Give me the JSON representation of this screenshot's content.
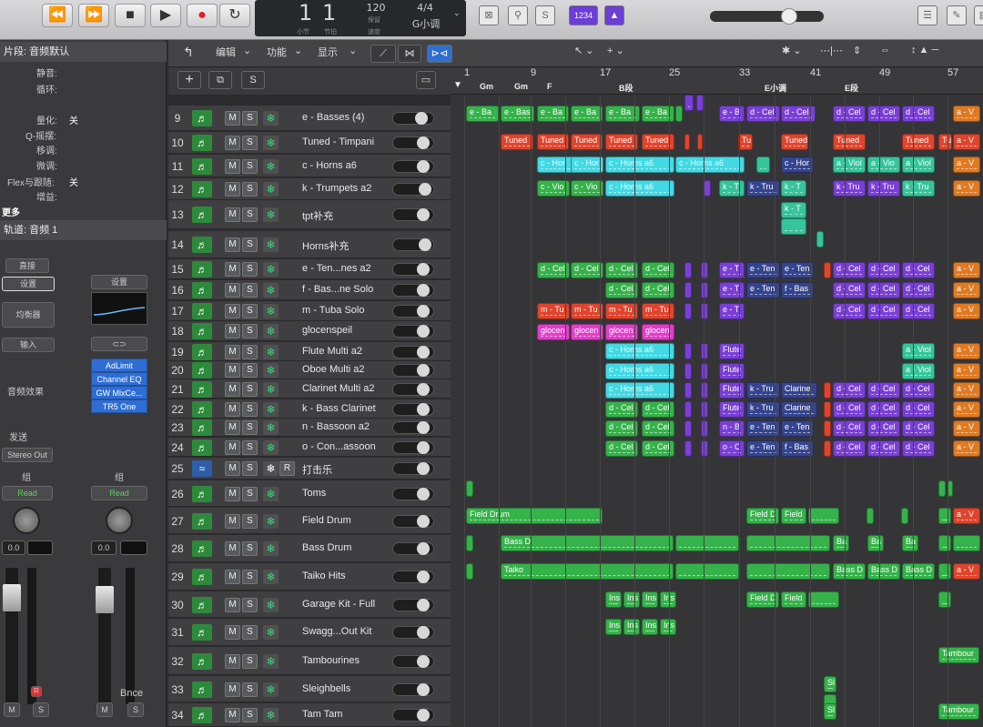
{
  "transport": {
    "bar": "1",
    "beat": "1",
    "bar_caption": "小节",
    "beat_caption": "节拍",
    "tempo": "120",
    "tempo_sub": "保留",
    "tempo_caption": "速度",
    "signature": "4/4",
    "key": "G小调",
    "count_in": "1234"
  },
  "inspector": {
    "region_title": "片段: 音频默认",
    "rows": [
      {
        "label": "静音:",
        "value": ""
      },
      {
        "label": "循环:",
        "value": ""
      },
      {
        "label": "量化:",
        "value": "关"
      },
      {
        "label": "Q-摇摆:",
        "value": ""
      },
      {
        "label": "移调:",
        "value": ""
      },
      {
        "label": "微调:",
        "value": ""
      },
      {
        "label": "Flex与跟随:",
        "value": "关"
      },
      {
        "label": "增益:",
        "value": ""
      }
    ],
    "more": "更多",
    "track_title": "轨道: 音频 1",
    "ch1": {
      "setting": "设置",
      "eq": "均衡器",
      "input": "输入",
      "fx": "音频效果",
      "send": "发送",
      "output": "Stereo Out",
      "group": "组",
      "automation": "Read",
      "value": "0.0"
    },
    "ch2": {
      "setting": "设置",
      "plugins": [
        "AdLimit",
        "Channel EQ",
        "GW MixCe...",
        "TR5 One"
      ],
      "group": "组",
      "automation": "Read",
      "value": "0.0",
      "name": "Bnce"
    },
    "direct": "直接"
  },
  "toolbar": {
    "edit": "编辑",
    "function": "功能",
    "view": "显示"
  },
  "tracks": [
    {
      "num": "9",
      "name": "e - Basses (4)"
    },
    {
      "num": "10",
      "name": "Tuned - Timpani"
    },
    {
      "num": "11",
      "name": "c - Horns a6"
    },
    {
      "num": "12",
      "name": "k - Trumpets a2"
    },
    {
      "num": "13",
      "name": "tpt补充"
    },
    {
      "num": "14",
      "name": "Horns补充"
    },
    {
      "num": "15",
      "name": "e - Ten...nes a2"
    },
    {
      "num": "16",
      "name": "f - Bas...ne Solo"
    },
    {
      "num": "17",
      "name": "m - Tuba Solo"
    },
    {
      "num": "18",
      "name": "glocenspeil"
    },
    {
      "num": "19",
      "name": "Flute Multi  a2"
    },
    {
      "num": "20",
      "name": "Oboe Multi a2"
    },
    {
      "num": "21",
      "name": "Clarinet Multi a2"
    },
    {
      "num": "22",
      "name": "k - Bass Clarinet"
    },
    {
      "num": "23",
      "name": "n - Bassoon a2"
    },
    {
      "num": "24",
      "name": "o - Con...assoon"
    },
    {
      "num": "25",
      "name": "打击乐"
    },
    {
      "num": "26",
      "name": "Toms"
    },
    {
      "num": "27",
      "name": "Field Drum"
    },
    {
      "num": "28",
      "name": "Bass Drum"
    },
    {
      "num": "29",
      "name": "Taiko Hits"
    },
    {
      "num": "30",
      "name": "Garage Kit - Full"
    },
    {
      "num": "31",
      "name": "Swagg...Out Kit"
    },
    {
      "num": "32",
      "name": "Tambourines"
    },
    {
      "num": "33",
      "name": "Sleighbells"
    },
    {
      "num": "34",
      "name": "Tam Tam"
    }
  ],
  "ruler": {
    "bars": [
      "1",
      "9",
      "17",
      "25",
      "33",
      "41",
      "49",
      "57"
    ],
    "markers": [
      "Gm",
      "Gm",
      "F",
      "B段",
      "E小调",
      "E段"
    ]
  },
  "regions": {
    "basses": "e - Ba",
    "basses_b": "e - Bas",
    "bass_b": "e - B",
    "cel": "d - Cel",
    "tuned": "Tuned",
    "tu": "Tu",
    "horns": "c - Hor",
    "horns_a6": "c - Horns a6",
    "viol": "a - Viol",
    "vio": "a - Vio",
    "v": "a - V",
    "cvio": "c - Vio",
    "ktru": "k - Tru",
    "kt": "k - T",
    "eten": "e - Ten",
    "et": "e - T",
    "fbas": "f - Bas",
    "mtu": "m - Tu",
    "glocen": "glocen",
    "flute": "Flute",
    "clarine": "Clarine",
    "nbe": "n - B",
    "oc": "o - C",
    "field": "Field Drum",
    "fieldd": "Field D",
    "fieldshort": "Field",
    "bassd": "Bass D",
    "ba": "Ba",
    "taiko": "Taiko",
    "ins": "Ins",
    "tambour": "Tambour",
    "si": "Sl"
  }
}
